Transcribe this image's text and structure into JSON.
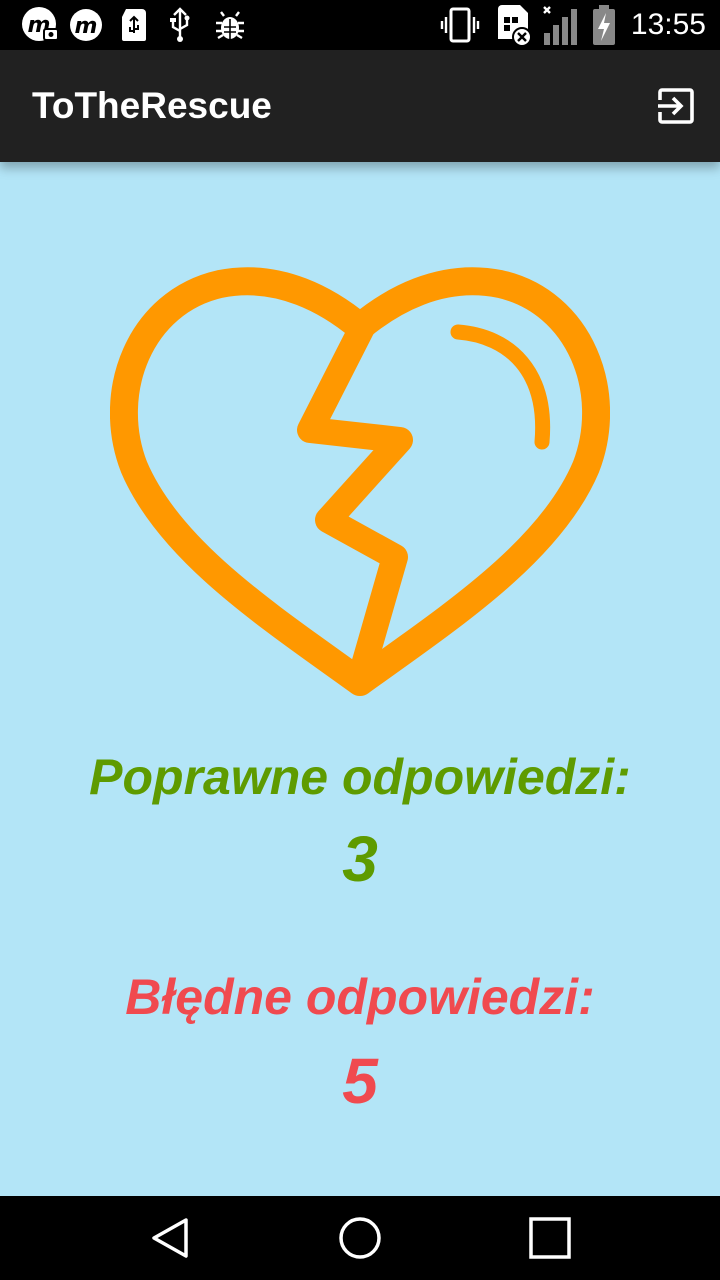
{
  "status_bar": {
    "time": "13:55",
    "icons": [
      "m-camera-notification-icon",
      "m-notification-icon",
      "sd-card-icon",
      "usb-icon",
      "bug-icon",
      "vibrate-icon",
      "sim-card-error-icon",
      "signal-icon",
      "battery-charging-icon"
    ]
  },
  "app_bar": {
    "title": "ToTheRescue",
    "action_icon": "logout-icon"
  },
  "result": {
    "image_icon": "broken-heart-icon",
    "correct_label": "Poprawne odpowiedzi:",
    "correct_value": "3",
    "wrong_label": "Błędne odpowiedzi:",
    "wrong_value": "5"
  },
  "colors": {
    "background": "#b3e5f7",
    "app_bar": "#212121",
    "heart": "#ff9800",
    "correct": "#5e9b00",
    "wrong": "#f04a4f"
  },
  "nav_bar": {
    "buttons": [
      "back-icon",
      "home-icon",
      "recents-icon"
    ]
  }
}
